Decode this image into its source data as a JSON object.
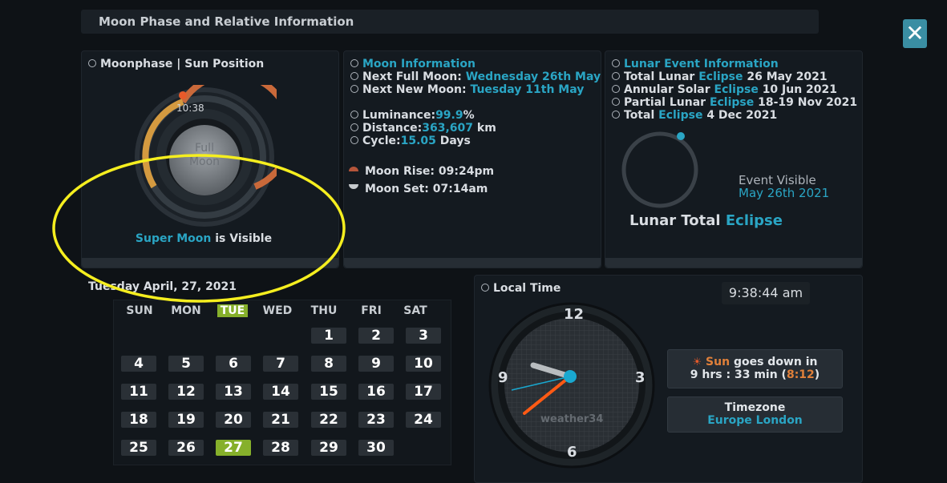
{
  "title": "Moon Phase and Relative Information",
  "close_glyph": "✕",
  "moonphase": {
    "header": "Moonphase | Sun Position",
    "time": "10:38",
    "phase_line1": "Full",
    "phase_line2": "Moon",
    "supermoon_highlight": "Super Moon",
    "supermoon_rest": "is Visible"
  },
  "moon_info": {
    "header": "Moon Information",
    "next_full_label": "Next Full Moon:",
    "next_full_value": "Wednesday 26th May",
    "next_new_label": "Next New Moon:",
    "next_new_value": "Tuesday 11th May",
    "luminance_label": "Luminance:",
    "luminance_value": "99.9",
    "luminance_unit": "%",
    "distance_label": "Distance:",
    "distance_value": "363,607",
    "distance_unit": "km",
    "cycle_label": "Cycle:",
    "cycle_value": "15.05",
    "cycle_unit": "Days",
    "moon_rise": "Moon Rise: 09:24pm",
    "moon_set": "Moon Set: 07:14am"
  },
  "lunar_event": {
    "header": "Lunar Event Information",
    "events": [
      {
        "pre": "Total Lunar",
        "eclipse": "Eclipse",
        "date": "26 May 2021"
      },
      {
        "pre": "Annular Solar",
        "eclipse": "Eclipse",
        "date": "10 Jun 2021"
      },
      {
        "pre": "Partial Lunar",
        "eclipse": "Eclipse",
        "date": "18-19 Nov 2021"
      },
      {
        "pre": "Total",
        "eclipse": "Eclipse",
        "date": "4 Dec 2021"
      }
    ],
    "event_visible_label": "Event Visible",
    "event_visible_date": "May 26th 2021",
    "lunar_total_label": "Lunar Total",
    "lunar_total_eclipse": "Eclipse"
  },
  "calendar": {
    "date_title": "Tuesday April, 27, 2021",
    "weekdays": [
      "SUN",
      "MON",
      "TUE",
      "WED",
      "THU",
      "FRI",
      "SAT"
    ],
    "days": [
      "1",
      "2",
      "3",
      "4",
      "5",
      "6",
      "7",
      "8",
      "9",
      "10",
      "11",
      "12",
      "13",
      "14",
      "15",
      "16",
      "17",
      "18",
      "19",
      "20",
      "21",
      "22",
      "23",
      "24",
      "25",
      "26",
      "27",
      "28",
      "29",
      "30"
    ],
    "today": "27"
  },
  "local_time": {
    "header": "Local Time",
    "digital_time": "9:38:44 am",
    "numerals": [
      "12",
      "3",
      "6",
      "9"
    ],
    "brand": "weather34",
    "sun_word": "Sun",
    "sun_rest": "goes down in",
    "sun_countdown": "9 hrs : 33 min (",
    "sun_time": "8:12",
    "sun_close": ")",
    "timezone_label": "Timezone",
    "timezone_value": "Europe London"
  },
  "colors": {
    "accent": "#2aa5c4",
    "orange": "#e0803a",
    "green": "#86b02b",
    "annotation": "#f5ee1f"
  }
}
